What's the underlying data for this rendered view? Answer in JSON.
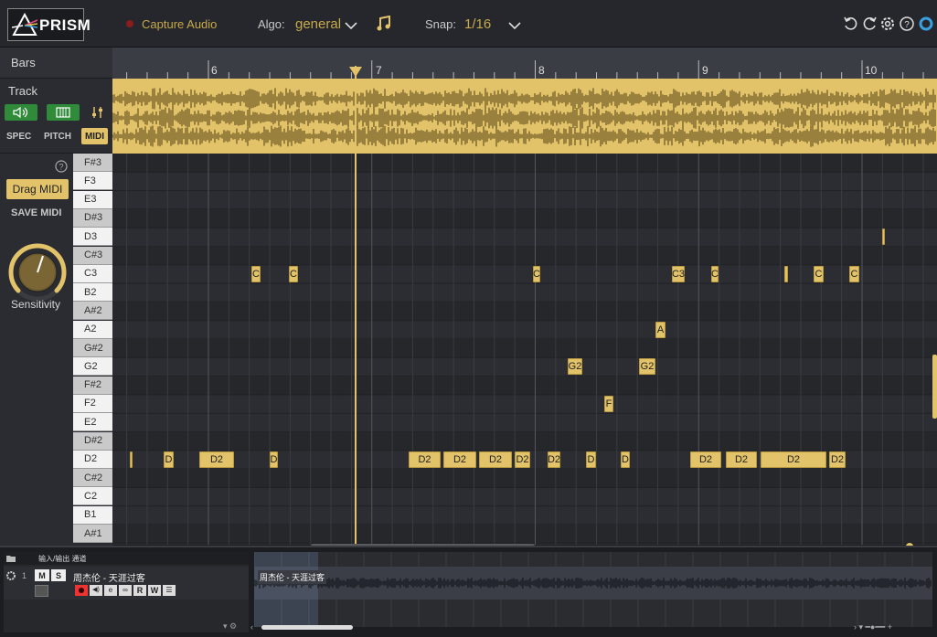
{
  "app": {
    "logo_text": "PRISM",
    "capture_audio": "Capture Audio",
    "algo_label": "Algo:",
    "algo_value": "general",
    "snap_label": "Snap:",
    "snap_value": "1/16"
  },
  "left": {
    "bars_label": "Bars",
    "track_label": "Track",
    "spec": "SPEC",
    "pitch": "PITCH",
    "midi": "MIDI",
    "help": "?",
    "drag_midi": "Drag MIDI",
    "save_midi": "SAVE MIDI",
    "sensitivity": "Sensitivity"
  },
  "ruler": {
    "bars": [
      "6",
      "7",
      "8",
      "9",
      "10"
    ]
  },
  "keys": [
    "F#3",
    "F3",
    "E3",
    "D#3",
    "D3",
    "C#3",
    "C3",
    "B2",
    "A#2",
    "A2",
    "G#2",
    "G2",
    "F#2",
    "F2",
    "E2",
    "D#2",
    "D2",
    "C#2",
    "C2",
    "B1",
    "A#1"
  ],
  "notes": [
    {
      "label": "C",
      "row": "C3"
    },
    {
      "label": "C",
      "row": "C3"
    },
    {
      "label": "C",
      "row": "C3"
    },
    {
      "label": "C3",
      "row": "C3"
    },
    {
      "label": "C",
      "row": "C3"
    },
    {
      "label": "",
      "row": "C3"
    },
    {
      "label": "C",
      "row": "C3"
    },
    {
      "label": "C",
      "row": "C3"
    },
    {
      "label": "",
      "row": "D3"
    },
    {
      "label": "A",
      "row": "A2"
    },
    {
      "label": "G2",
      "row": "G2"
    },
    {
      "label": "G2",
      "row": "G2"
    },
    {
      "label": "F",
      "row": "F2"
    },
    {
      "label": "",
      "row": "D2"
    },
    {
      "label": "D",
      "row": "D2"
    },
    {
      "label": "D2",
      "row": "D2"
    },
    {
      "label": "D",
      "row": "D2"
    },
    {
      "label": "D2",
      "row": "D2"
    },
    {
      "label": "D2",
      "row": "D2"
    },
    {
      "label": "D2",
      "row": "D2"
    },
    {
      "label": "D2",
      "row": "D2"
    },
    {
      "label": "D2",
      "row": "D2"
    },
    {
      "label": "D",
      "row": "D2"
    },
    {
      "label": "D",
      "row": "D2"
    },
    {
      "label": "D2",
      "row": "D2"
    },
    {
      "label": "D2",
      "row": "D2"
    },
    {
      "label": "D2",
      "row": "D2"
    },
    {
      "label": "D2",
      "row": "D2"
    }
  ],
  "daw": {
    "header_label": "输入/输出 通道",
    "track_number": "1",
    "m": "M",
    "s": "S",
    "track_name": "周杰伦 - 天涯过客",
    "r": "R",
    "w": "W",
    "clip_name": "周杰伦 - 天涯过客"
  },
  "colors": {
    "accent": "#e2c36a",
    "green": "#2f8a3a",
    "grid_bg": "#2b2d32"
  }
}
